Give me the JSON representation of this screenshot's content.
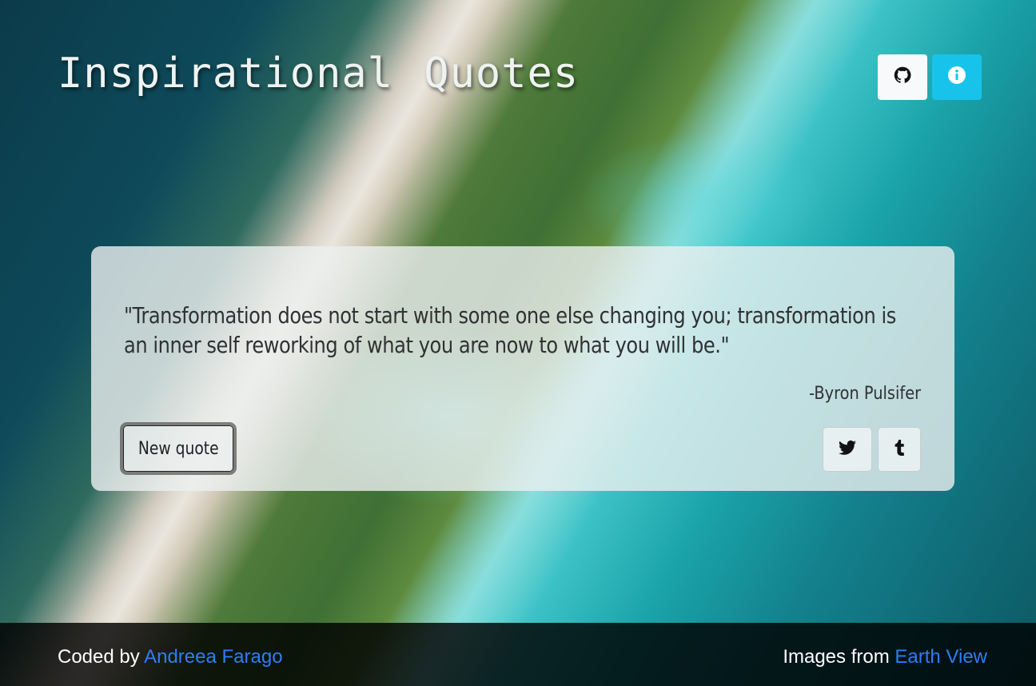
{
  "header": {
    "title": "Inspirational  Quotes"
  },
  "top_buttons": [
    {
      "icon": "github-icon"
    },
    {
      "icon": "info-icon",
      "color": "#17c3ea"
    }
  ],
  "quote": {
    "text": "\"Transformation does not start with some one else changing you; transformation is an inner self reworking of what you are now to what you will be.\"",
    "author": "-Byron Pulsifer"
  },
  "actions": {
    "new_quote_label": "New quote",
    "share_icons": [
      "twitter-icon",
      "tumblr-icon"
    ]
  },
  "footer": {
    "coded_by_prefix": "Coded by ",
    "coded_by_link": "Andreea Farago",
    "images_prefix": "Images from ",
    "images_link": "Earth View",
    "link_color": "#2f7cf6"
  }
}
